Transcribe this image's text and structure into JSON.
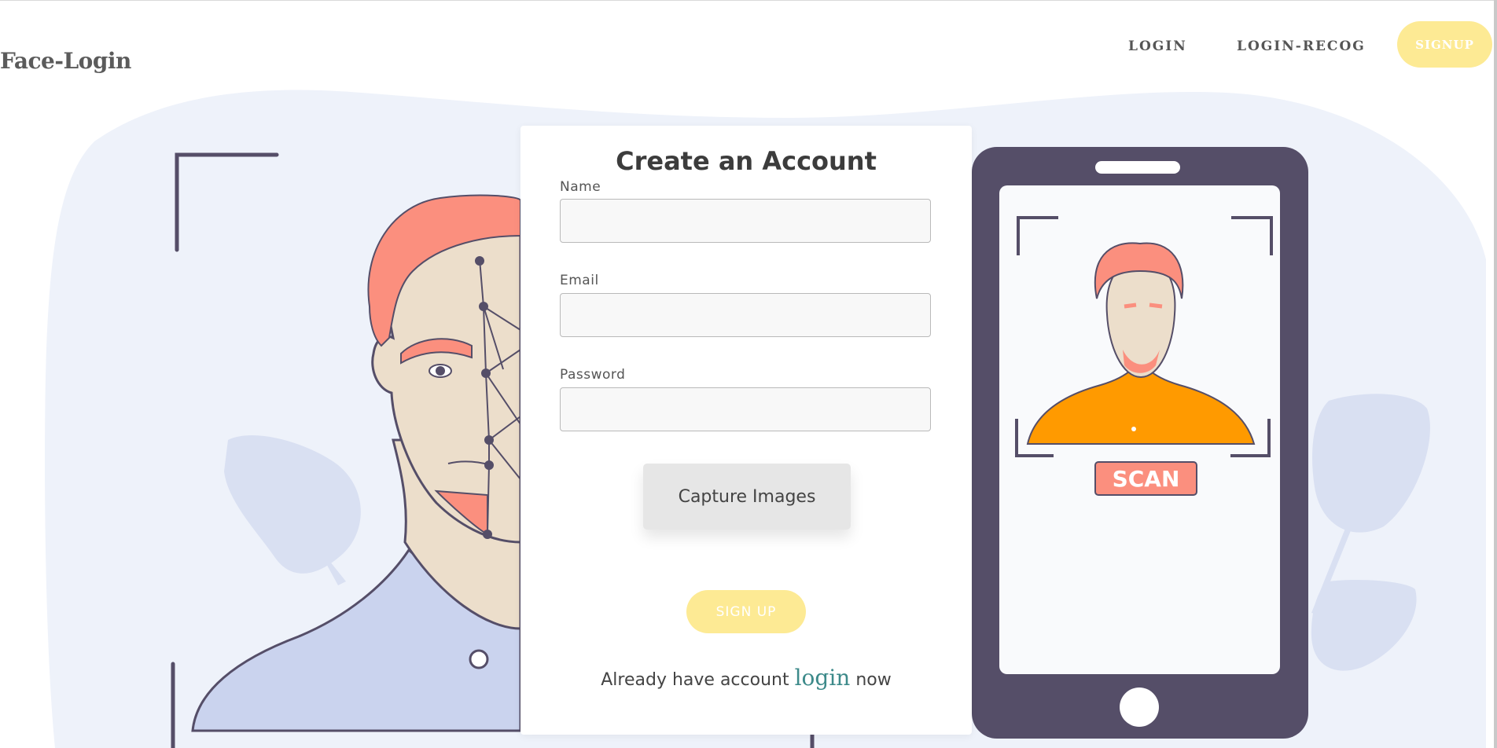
{
  "header": {
    "brand": "Face-Login",
    "nav": {
      "login": "LOGIN",
      "login_recog": "LOGIN-RECOG",
      "signup": "SIGNUP"
    }
  },
  "form": {
    "title": "Create an Account",
    "name_label": "Name",
    "name_value": "",
    "email_label": "Email",
    "email_value": "",
    "password_label": "Password",
    "password_value": "",
    "capture_button": "Capture Images",
    "signup_button": "SIGN UP",
    "footer_prefix": "Already have account",
    "footer_link": "login",
    "footer_suffix": "now"
  },
  "illustration": {
    "phone_badge": "SCAN"
  },
  "colors": {
    "accent_yellow": "#fdea94",
    "blob": "#eef2fa",
    "phone_body": "#554e68",
    "hair": "#fb8f7e",
    "shirt_orange": "#ff9a00",
    "shirt_blue": "#cad3ee",
    "link_teal": "#3d8a8a"
  }
}
